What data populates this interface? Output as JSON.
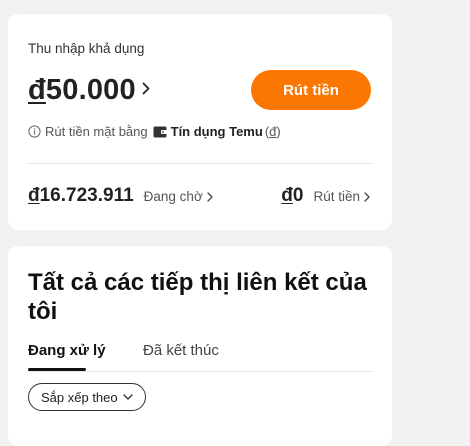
{
  "income": {
    "label": "Thu nhập khả dụng",
    "currency": "đ",
    "amount": "50.000",
    "withdraw_button": "Rút tiền",
    "note_prefix": "Rút tiền mặt bằng",
    "note_credit": "Tín dụng Temu",
    "note_open": "(",
    "note_currency": "đ",
    "note_close": ")"
  },
  "pending": {
    "currency": "đ",
    "amount": "16.723.911",
    "label": "Đang chờ"
  },
  "withdrawn": {
    "currency": "đ",
    "amount": "0",
    "label": "Rút tiền"
  },
  "affiliate": {
    "title": "Tất cả các tiếp thị liên kết của tôi",
    "tabs": [
      {
        "label": "Đang xử lý",
        "active": true
      },
      {
        "label": "Đã kết thúc",
        "active": false
      }
    ],
    "sort_label": "Sắp xếp theo"
  },
  "colors": {
    "accent": "#fb7701",
    "background": "#f2f2f2",
    "card": "#ffffff"
  },
  "icons": [
    "chevron-right-icon",
    "info-icon",
    "wallet-icon",
    "chevron-down-icon"
  ]
}
